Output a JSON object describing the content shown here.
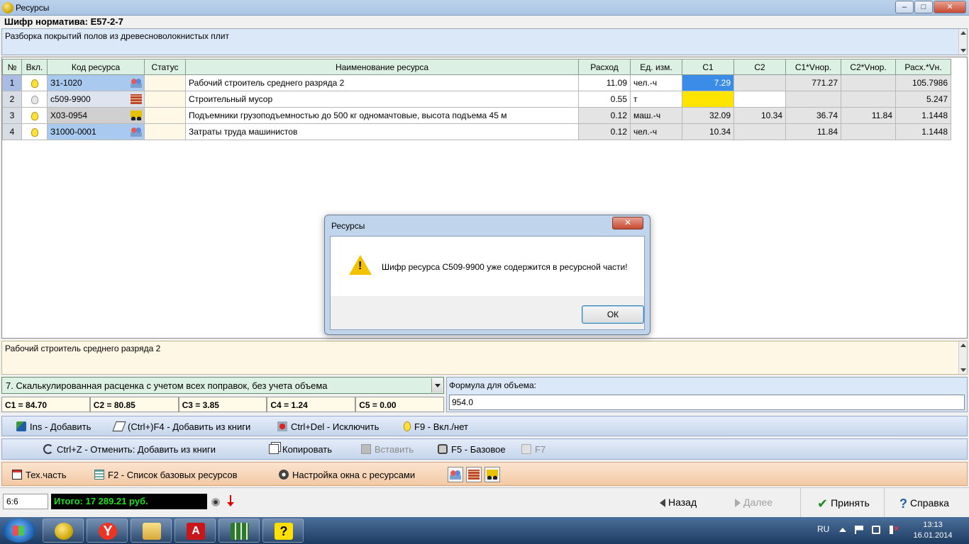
{
  "window": {
    "title": "Ресурсы",
    "min_glyph": "–",
    "max_glyph": "□",
    "close_glyph": "✕"
  },
  "normative": {
    "title": "Шифр норматива: Е57-2-7",
    "description": "Разборка покрытий полов из древесноволокнистых плит"
  },
  "grid": {
    "columns": [
      "№",
      "Вкл.",
      "Код ресурса",
      "Статус",
      "Наименование ресурса",
      "Расход",
      "Ед. изм.",
      "С1",
      "С2",
      "С1*Vнор.",
      "С2*Vнор.",
      "Расх.*Vн."
    ],
    "rows": [
      {
        "n": "1",
        "on": true,
        "code": "З1-1020",
        "type": "workers",
        "status": "",
        "name": "Рабочий строитель среднего разряда 2",
        "rashod": "11.09",
        "ed": "чел.-ч",
        "c1": "7.29",
        "c2": "",
        "c1v": "771.27",
        "c2v": "",
        "rv": "105.7986"
      },
      {
        "n": "2",
        "on": false,
        "code": "с509-9900",
        "type": "bricks",
        "status": "",
        "name": "Строительный мусор",
        "rashod": "0.55",
        "ed": "т",
        "c1": "",
        "c2": "",
        "c1v": "",
        "c2v": "",
        "rv": "5.247"
      },
      {
        "n": "3",
        "on": true,
        "code": "Х03-0954",
        "type": "truck",
        "status": "",
        "name": "Подъемники грузоподъемностью до 500 кг одномачтовые, высота подъема 45 м",
        "rashod": "0.12",
        "ed": "маш.-ч",
        "c1": "32.09",
        "c2": "10.34",
        "c1v": "36.74",
        "c2v": "11.84",
        "rv": "1.1448"
      },
      {
        "n": "4",
        "on": true,
        "code": "З1000-0001",
        "type": "workers",
        "status": "",
        "name": "Затраты труда машинистов",
        "rashod": "0.12",
        "ed": "чел.-ч",
        "c1": "10.34",
        "c2": "",
        "c1v": "11.84",
        "c2v": "",
        "rv": "1.1448"
      }
    ]
  },
  "info": {
    "text": "Рабочий строитель среднего разряда 2"
  },
  "calc": {
    "selected": "7. Скалькулированная расценка с учетом всех поправок, без учета объема",
    "coefs": [
      "С1 = 84.70",
      "С2 = 80.85",
      "С3 = 3.85",
      "С4 = 1.24",
      "С5 = 0.00"
    ]
  },
  "formula": {
    "label": "Формула для объема:",
    "value": "954.0"
  },
  "toolbar1": {
    "add": "Ins - Добавить",
    "add_book": "(Ctrl+)F4 - Добавить из книги",
    "exclude": "Ctrl+Del - Исключить",
    "toggle": "F9 - Вкл./нет"
  },
  "toolbar2": {
    "undo": "Ctrl+Z - Отменить: Добавить из книги",
    "copy": "Копировать",
    "paste": "Вставить",
    "base": "F5 - Базовое",
    "f7": "F7"
  },
  "toolbar3": {
    "techpart": "Тех.часть",
    "base_list": "F2 - Список базовых ресурсов",
    "settings": "Настройка окна с ресурсами"
  },
  "status": {
    "pos": "6:6",
    "total": "Итого: 17 289.21 руб.",
    "back": "Назад",
    "next": "Далее",
    "accept": "Принять",
    "help": "Справка"
  },
  "dialog": {
    "title": "Ресурсы",
    "message": "Шифр ресурса С509-9900 уже содержится в ресурсной части!",
    "ok": "ОК",
    "close_glyph": "✕"
  },
  "taskbar": {
    "ya_glyph": "Y",
    "pdf_glyph": "A",
    "help_glyph": "?",
    "lang": "RU",
    "time": "13:13",
    "date": "16.01.2014"
  }
}
